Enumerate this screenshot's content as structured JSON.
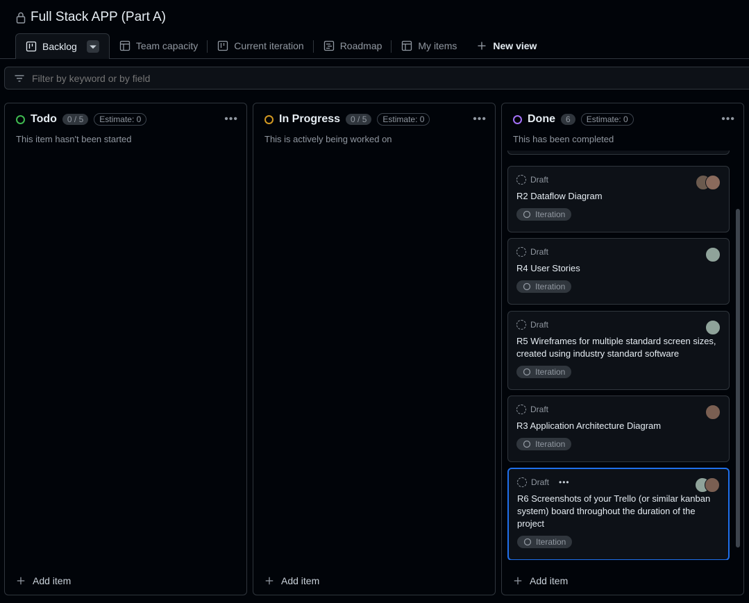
{
  "project": {
    "title": "Full Stack APP (Part A)"
  },
  "tabs": [
    {
      "label": "Backlog",
      "icon": "board-icon"
    },
    {
      "label": "Team capacity",
      "icon": "table-icon"
    },
    {
      "label": "Current iteration",
      "icon": "board-icon"
    },
    {
      "label": "Roadmap",
      "icon": "roadmap-icon"
    },
    {
      "label": "My items",
      "icon": "table-icon"
    },
    {
      "label": "New view",
      "icon": "plus-icon"
    }
  ],
  "filter": {
    "placeholder": "Filter by keyword or by field"
  },
  "columns": [
    {
      "name": "Todo",
      "count": "0 / 5",
      "estimate": "Estimate: 0",
      "description": "This item hasn't been started",
      "color": "#3fb950",
      "add_label": "Add item"
    },
    {
      "name": "In Progress",
      "count": "0 / 5",
      "estimate": "Estimate: 0",
      "description": "This is actively being worked on",
      "color": "#d29922",
      "add_label": "Add item"
    },
    {
      "name": "Done",
      "count": "6",
      "estimate": "Estimate: 0",
      "description": "This has been completed",
      "color": "#a371f7",
      "add_label": "Add item"
    }
  ],
  "cards": [
    {
      "status": "Draft",
      "title": "R2 Dataflow Diagram",
      "iteration": "Iteration"
    },
    {
      "status": "Draft",
      "title": "R4 User Stories",
      "iteration": "Iteration"
    },
    {
      "status": "Draft",
      "title": "R5 Wireframes for multiple standard screen sizes, created using industry standard software",
      "iteration": "Iteration"
    },
    {
      "status": "Draft",
      "title": "R3 Application Architecture Diagram",
      "iteration": "Iteration"
    },
    {
      "status": "Draft",
      "title": "R6 Screenshots of your Trello (or similar kanban system) board throughout the duration of the project",
      "iteration": "Iteration"
    }
  ],
  "colors": {
    "background": "#010409",
    "card": "#0d1117",
    "border": "#30363d",
    "accent": "#1f6feb"
  }
}
